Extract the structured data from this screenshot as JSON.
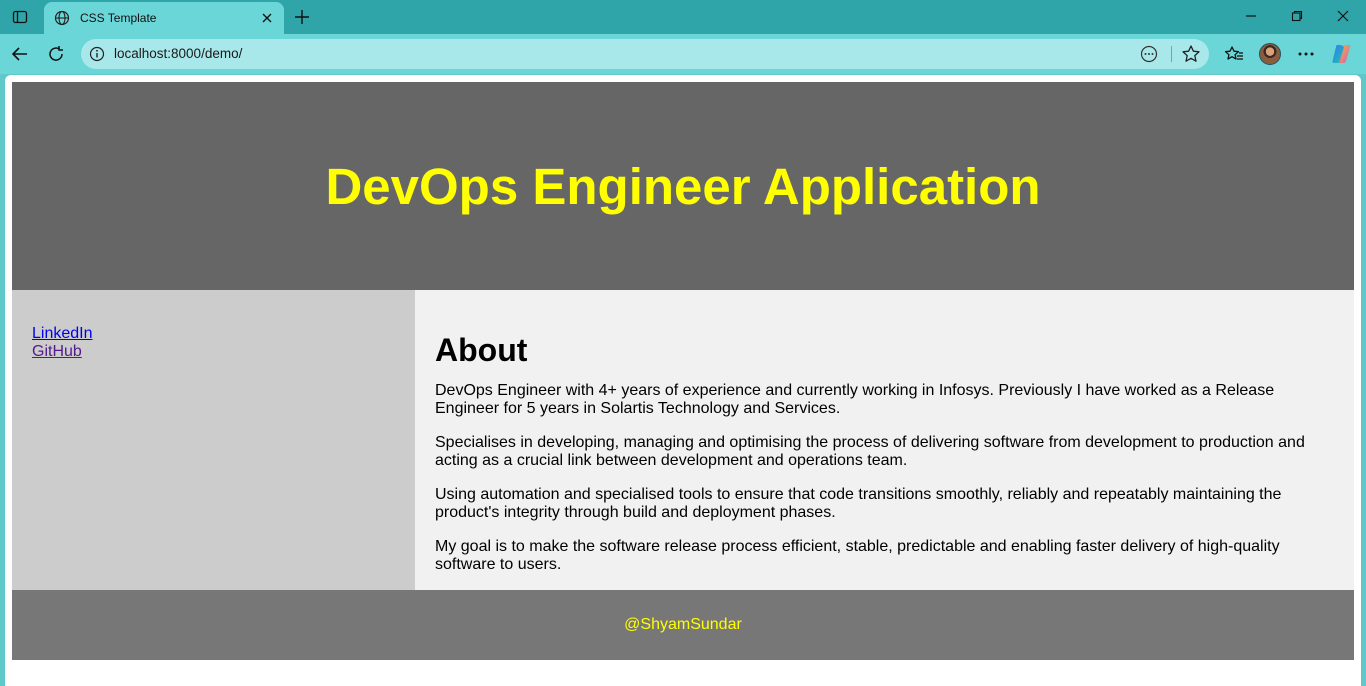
{
  "browser": {
    "tab_title": "CSS Template",
    "url": "localhost:8000/demo/"
  },
  "page": {
    "header_title": "DevOps Engineer Application",
    "sidebar_links": [
      "LinkedIn",
      "GitHub"
    ],
    "about": {
      "heading": "About",
      "paragraphs": [
        "DevOps Engineer with 4+ years of experience and currently working in Infosys. Previously I have worked as a Release Engineer for 5 years in Solartis Technology and Services.",
        "Specialises in developing, managing and optimising the process of delivering software from development to production and acting as a crucial link between development and operations team.",
        "Using automation and specialised tools to ensure that code transitions smoothly, reliably and repeatably maintaining the product's integrity through build and deployment phases.",
        "My goal is to make the software release process efficient, stable, predictable and enabling faster delivery of high-quality software to users."
      ]
    },
    "footer_text": "@ShyamSundar"
  },
  "colors": {
    "header_bg": "#666666",
    "header_text": "#ffff00",
    "sidebar_bg": "#cccccc",
    "main_bg": "#f1f1f1",
    "footer_bg": "#777777",
    "chrome": "#6ad6d8"
  },
  "icons": [
    "tab-actions-icon",
    "globe-icon",
    "close-icon",
    "plus-icon",
    "minimize-icon",
    "restore-icon",
    "window-close-icon",
    "back-icon",
    "reload-icon",
    "info-icon",
    "reading-mode-icon",
    "star-icon",
    "favorites-icon",
    "more-icon",
    "copilot-icon"
  ]
}
